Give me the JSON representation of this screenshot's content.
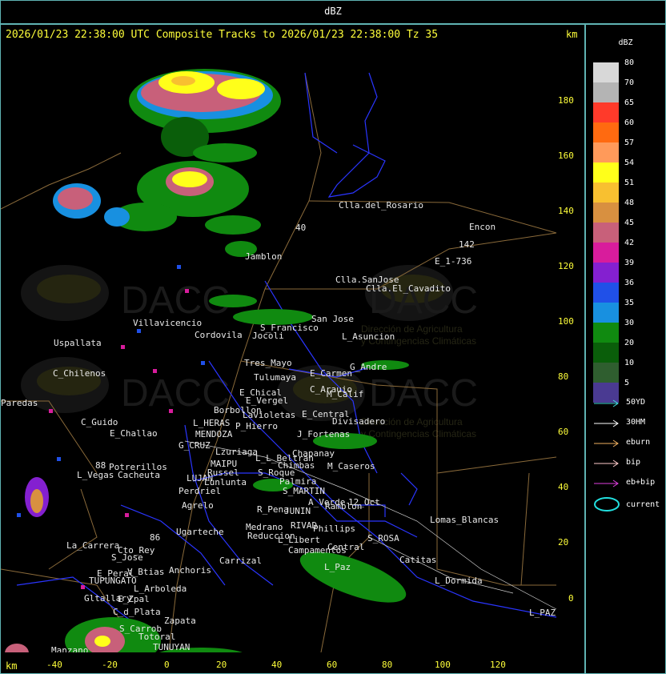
{
  "top_title": "dBZ",
  "header": "2026/01/23 22:38:00 UTC Composite Tracks to 2026/01/23 22:38:00 Tz 35",
  "units_top": "km",
  "units_bottom": "km",
  "y_ticks": [
    "180",
    "160",
    "140",
    "120",
    "100",
    "80",
    "60",
    "40",
    "20",
    "0"
  ],
  "x_ticks": [
    "-40",
    "-20",
    "0",
    "20",
    "40",
    "60",
    "80",
    "100",
    "120"
  ],
  "watermark": {
    "text": "DACC",
    "subtitle_1": "Dirección de Agricultura",
    "subtitle_2": "y Contingencias Climáticas"
  },
  "places": [
    {
      "name": "Clla.del_Rosario"
    },
    {
      "name": "Encon"
    },
    {
      "name": "142"
    },
    {
      "name": "E_1-736"
    },
    {
      "name": "Jamblon"
    },
    {
      "name": "Clla.SanJose"
    },
    {
      "name": "Clla.El_Cavadito"
    },
    {
      "name": "Villavicencio"
    },
    {
      "name": "Uspallata"
    },
    {
      "name": "Cordovila"
    },
    {
      "name": "S_Francisco"
    },
    {
      "name": "Jocoli"
    },
    {
      "name": "San Jose"
    },
    {
      "name": "L_Asuncion"
    },
    {
      "name": "C_Chilenos"
    },
    {
      "name": "Tres_Mayo"
    },
    {
      "name": "Tulumaya"
    },
    {
      "name": "E_Carmen"
    },
    {
      "name": "G_Andre"
    },
    {
      "name": "E_Chical"
    },
    {
      "name": "C_Arauio"
    },
    {
      "name": "M_Calif"
    },
    {
      "name": "E_Vergel"
    },
    {
      "name": "Paredas"
    },
    {
      "name": "Borbollon"
    },
    {
      "name": "Lavioletas"
    },
    {
      "name": "E_Central"
    },
    {
      "name": "Divisadero"
    },
    {
      "name": "C_Guido"
    },
    {
      "name": "L_HERAS"
    },
    {
      "name": "P_Hierro"
    },
    {
      "name": "E_Challao"
    },
    {
      "name": "MENDOZA"
    },
    {
      "name": "J_Fortenas"
    },
    {
      "name": "G_CRUZ"
    },
    {
      "name": "Lzuriaga"
    },
    {
      "name": "L_L_Beltran"
    },
    {
      "name": "Chapanay"
    },
    {
      "name": "Chimbas"
    },
    {
      "name": "M_Caseros"
    },
    {
      "name": "Potrerillos"
    },
    {
      "name": "MAIPU"
    },
    {
      "name": "L_Vegas"
    },
    {
      "name": "Cacheuta"
    },
    {
      "name": "Russel"
    },
    {
      "name": "S_Roque"
    },
    {
      "name": "LUJAN"
    },
    {
      "name": "Lunlunta"
    },
    {
      "name": "Palmira"
    },
    {
      "name": "Perdriel"
    },
    {
      "name": "S_MARTIN"
    },
    {
      "name": "Agrelo"
    },
    {
      "name": "A_Verde"
    },
    {
      "name": "R_Pena"
    },
    {
      "name": "JUNIN"
    },
    {
      "name": "Ramblon"
    },
    {
      "name": "Lomas_Blancas"
    },
    {
      "name": "Ugarteche"
    },
    {
      "name": "Medrano"
    },
    {
      "name": "RIVAD"
    },
    {
      "name": "Phillips"
    },
    {
      "name": "Reduccion"
    },
    {
      "name": "L_Libert"
    },
    {
      "name": "S_ROSA"
    },
    {
      "name": "La_Carrera"
    },
    {
      "name": "Cto_Rey"
    },
    {
      "name": "Campamentos"
    },
    {
      "name": "Central"
    },
    {
      "name": "S_Jose"
    },
    {
      "name": "Carrizal"
    },
    {
      "name": "Catitas"
    },
    {
      "name": "L_Paz"
    },
    {
      "name": "E_Peral"
    },
    {
      "name": "V_Btias"
    },
    {
      "name": "Anchoris"
    },
    {
      "name": "TUPUNGATO"
    },
    {
      "name": "L_Dormida"
    },
    {
      "name": "L_Arboleda"
    },
    {
      "name": "Gltallary"
    },
    {
      "name": "E_Zpal"
    },
    {
      "name": "L_PAZ"
    },
    {
      "name": "C_d_Plata"
    },
    {
      "name": "Zapata"
    },
    {
      "name": "S_Carrob"
    },
    {
      "name": "Totoral"
    },
    {
      "name": "TUNUYAN"
    },
    {
      "name": "Manzano"
    },
    {
      "name": "12_Oct"
    },
    {
      "name": "88"
    },
    {
      "name": "86"
    },
    {
      "name": "40"
    }
  ],
  "legend": {
    "title": "dBZ",
    "colorbar": [
      {
        "label": "80",
        "color": "#d8d8d8"
      },
      {
        "label": "70",
        "color": "#b4b4b4"
      },
      {
        "label": "65",
        "color": "#ff3a2a"
      },
      {
        "label": "60",
        "color": "#ff6a10"
      },
      {
        "label": "57",
        "color": "#ff9a5a"
      },
      {
        "label": "54",
        "color": "#ffff1a"
      },
      {
        "label": "51",
        "color": "#f8c030"
      },
      {
        "label": "48",
        "color": "#d89040"
      },
      {
        "label": "45",
        "color": "#c8607a"
      },
      {
        "label": "42",
        "color": "#d81c9c"
      },
      {
        "label": "39",
        "color": "#8420d0"
      },
      {
        "label": "36",
        "color": "#2050e8"
      },
      {
        "label": "35",
        "color": "#1890e0"
      },
      {
        "label": "30",
        "color": "#108a10"
      },
      {
        "label": "20",
        "color": "#0a5e0a"
      },
      {
        "label": "10",
        "color": "#2f5e2f"
      },
      {
        "label": "5",
        "color": "#4a3a92"
      }
    ],
    "tracks": [
      {
        "label": "50YD",
        "color": "#44dddd"
      },
      {
        "label": "30HM",
        "color": "#ffffff"
      },
      {
        "label": "eburn",
        "color": "#f0b060"
      },
      {
        "label": "bip",
        "color": "#ffcccc"
      },
      {
        "label": "eb+bip",
        "color": "#e040e0"
      }
    ],
    "current_label": "current",
    "current_color": "#22e0e0"
  }
}
